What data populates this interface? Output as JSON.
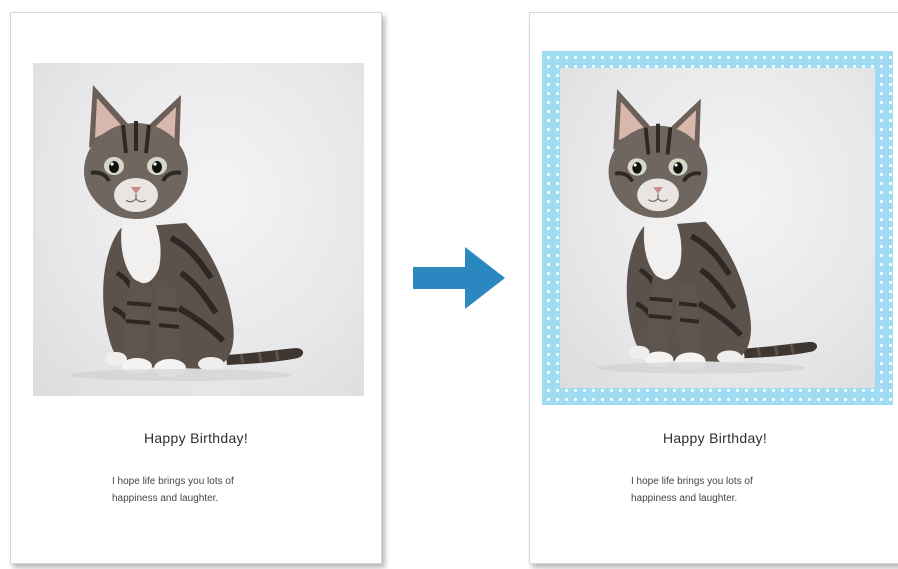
{
  "cards": {
    "before": {
      "greeting": "Happy Birthday!",
      "message_line1": "I hope life brings you lots of",
      "message_line2": "happiness and laughter."
    },
    "after": {
      "greeting": "Happy Birthday!",
      "message_line1": "I hope life brings you lots of",
      "message_line2": "happiness and laughter.",
      "frame_color": "#9fdcf2",
      "frame_pattern": "white polka dots"
    }
  },
  "arrow": {
    "icon": "arrow-right-icon",
    "color": "#2b87bf"
  },
  "photo": {
    "subject": "kitten-photo"
  }
}
